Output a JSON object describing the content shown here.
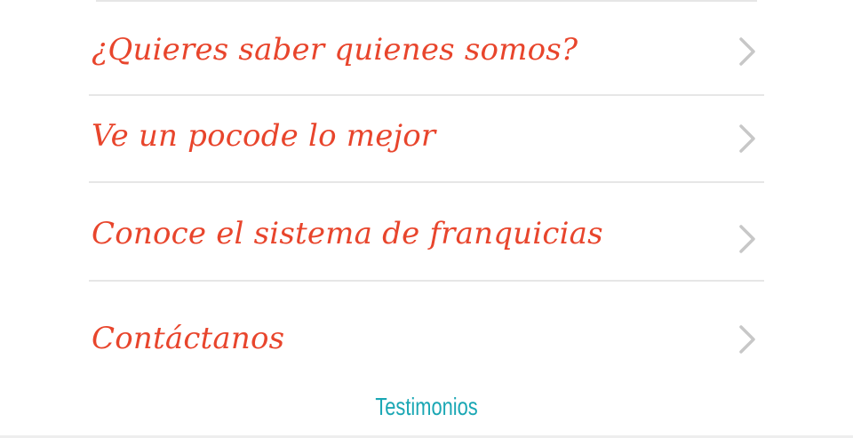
{
  "menu": {
    "items": [
      {
        "label": "¿Quieres saber quienes somos?",
        "icon": "chevron-right-icon"
      },
      {
        "label": "Ve un pocode lo mejor",
        "icon": "chevron-right-icon"
      },
      {
        "label": "Conoce el sistema de franquicias",
        "icon": "chevron-right-icon"
      },
      {
        "label": "Contáctanos",
        "icon": "chevron-right-icon"
      }
    ]
  },
  "footer": {
    "link_label": "Testimonios"
  },
  "colors": {
    "item_text": "#e8452c",
    "footer_link": "#1aa7b4",
    "chevron": "#c7c7c7",
    "divider": "#e6e6e6"
  }
}
